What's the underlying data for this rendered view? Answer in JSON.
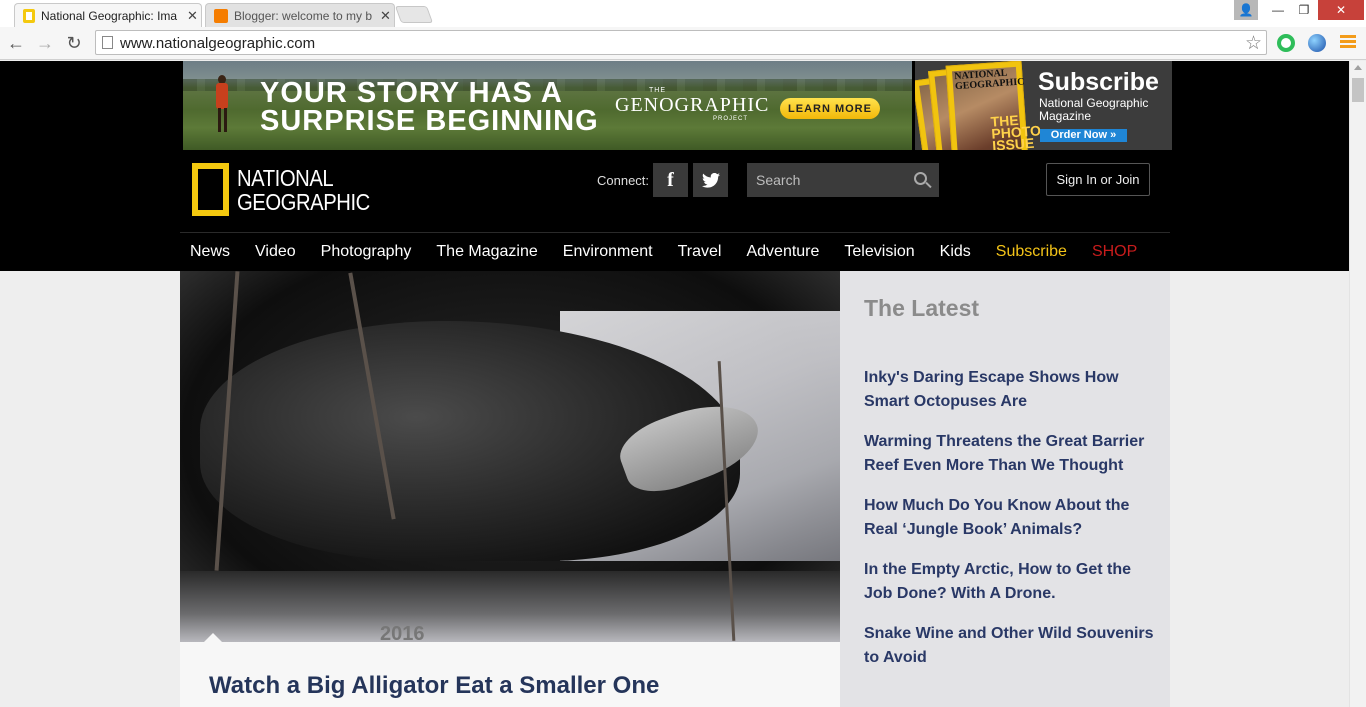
{
  "browser": {
    "tabs": [
      {
        "title": "National Geographic: Ima",
        "close": "✕"
      },
      {
        "title": "Blogger: welcome to my b",
        "close": "✕"
      }
    ],
    "url": "www.nationalgeographic.com",
    "colors": {
      "accent_menu": "#f39c1a"
    }
  },
  "ads": {
    "genographic": {
      "headline_line1": "YOUR STORY HAS A",
      "headline_line2": "SURPRISE BEGINNING",
      "brand_small": "THE",
      "brand_big": "GENOGRAPHIC",
      "brand_project": "PROJECT",
      "cta": "LEARN MORE"
    },
    "subscribe": {
      "magazine_title": "NATIONAL GEOGRAPHIC",
      "cover_text": "THE PHOTO ISSUE",
      "title": "Subscribe",
      "desc": "National Geographic Magazine",
      "cta": "Order Now »"
    }
  },
  "header": {
    "logo_line1": "NATIONAL",
    "logo_line2": "GEOGRAPHIC",
    "connect_label": "Connect:",
    "social": [
      {
        "name": "facebook-icon",
        "glyph": "f"
      },
      {
        "name": "twitter-icon",
        "glyph": "🐦"
      }
    ],
    "search_placeholder": "Search",
    "signin": "Sign In or Join",
    "colors": {
      "brand_yellow": "#f4c90f"
    }
  },
  "nav": {
    "items": [
      "News",
      "Video",
      "Photography",
      "The Magazine",
      "Environment",
      "Travel",
      "Adventure",
      "Television",
      "Kids",
      "Subscribe",
      "SHOP"
    ],
    "colors": {
      "subscribe": "#f3c318",
      "shop": "#c81c1c"
    }
  },
  "hero": {
    "caption_overlay": "2016",
    "headline": "Watch a Big Alligator Eat a Smaller One"
  },
  "latest": {
    "title": "The Latest",
    "items": [
      "Inky's Daring Escape Shows How Smart Octopuses Are",
      "Warming Threatens the Great Barrier Reef Even More Than We Thought",
      "How Much Do You Know About the Real ‘Jungle Book’ Animals?",
      "In the Empty Arctic, How to Get the Job Done?  With A Drone.",
      "Snake Wine and Other Wild Souvenirs to Avoid"
    ]
  }
}
